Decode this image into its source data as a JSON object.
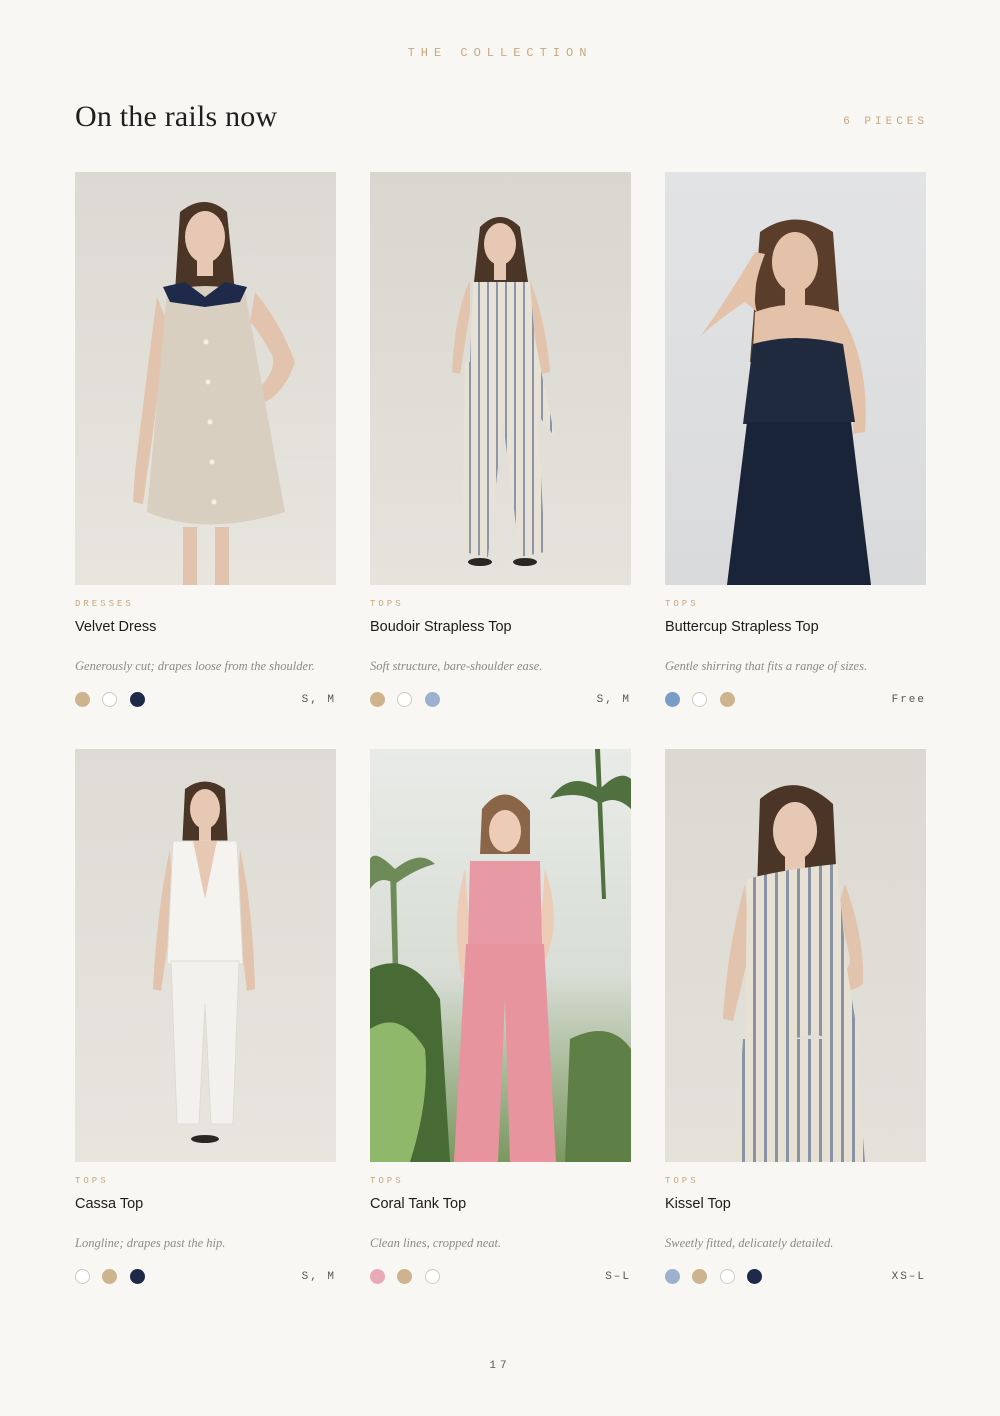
{
  "header": {
    "eyebrow": "THE COLLECTION",
    "title": "On the rails now",
    "count": "6 PIECES"
  },
  "colors": {
    "accent": "#c6a882",
    "background": "#f8f7f3"
  },
  "products": [
    {
      "category": "DRESSES",
      "name": "Velvet Dress",
      "description": "Generously cut; drapes loose from the shoulder.",
      "swatches": [
        "#cdb48f",
        "#ffffff",
        "#1f2a4a"
      ],
      "sizes": "S, M"
    },
    {
      "category": "TOPS",
      "name": "Boudoir Strapless Top",
      "description": "Soft structure, bare-shoulder ease.",
      "swatches": [
        "#cdb48f",
        "#ffffff",
        "#9db1cf"
      ],
      "sizes": "S, M"
    },
    {
      "category": "TOPS",
      "name": "Buttercup Strapless Top",
      "description": "Gentle shirring that fits a range of sizes.",
      "swatches": [
        "#7b9cc6",
        "#ffffff",
        "#cdb48f"
      ],
      "sizes": "Free"
    },
    {
      "category": "TOPS",
      "name": "Cassa Top",
      "description": "Longline; drapes past the hip.",
      "swatches": [
        "#ffffff",
        "#cdb48f",
        "#1f2a4a"
      ],
      "sizes": "S, M"
    },
    {
      "category": "TOPS",
      "name": "Coral Tank Top",
      "description": "Clean lines, cropped neat.",
      "swatches": [
        "#e7aab6",
        "#cdb48f",
        "#ffffff"
      ],
      "sizes": "S–L"
    },
    {
      "category": "TOPS",
      "name": "Kissel Top",
      "description": "Sweetly fitted, delicately detailed.",
      "swatches": [
        "#9db1cf",
        "#cdb48f",
        "#ffffff",
        "#1f2a4a"
      ],
      "sizes": "XS–L"
    }
  ],
  "footer": {
    "page_number": "17"
  }
}
